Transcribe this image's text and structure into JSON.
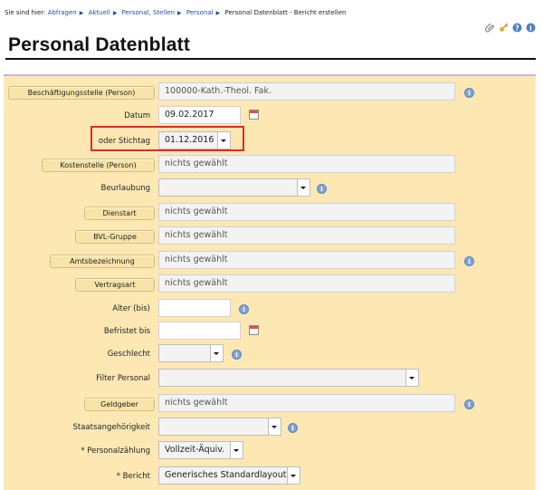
{
  "breadcrumb": {
    "prefix": "Sie sind hier:",
    "items": [
      "Abfragen",
      "Aktuell",
      "Personal, Stellen",
      "Personal",
      "Personal Datenblatt - Bericht erstellen"
    ]
  },
  "page_title": "Personal Datenblatt",
  "form": {
    "beschaeftigungsstelle": {
      "label": "Beschäftigungsstelle (Person)",
      "value": "100000-Kath.-Theol. Fak."
    },
    "datum": {
      "label": "Datum",
      "value": "09.02.2017"
    },
    "stichtag": {
      "label": "oder Stichtag",
      "value": "01.12.2016"
    },
    "kostenstelle": {
      "label": "Kostenstelle (Person)",
      "value": "nichts gewählt"
    },
    "beurlaubung": {
      "label": "Beurlaubung",
      "value": ""
    },
    "dienstart": {
      "label": "Dienstart",
      "value": "nichts gewählt"
    },
    "bvl_gruppe": {
      "label": "BVL-Gruppe",
      "value": "nichts gewählt"
    },
    "amtsbezeichnung": {
      "label": "Amtsbezeichnung",
      "value": "nichts gewählt"
    },
    "vertragsart": {
      "label": "Vertragsart",
      "value": "nichts gewählt"
    },
    "alter": {
      "label": "Alter (bis)",
      "value": ""
    },
    "befristet": {
      "label": "Befristet bis",
      "value": ""
    },
    "geschlecht": {
      "label": "Geschlecht",
      "value": ""
    },
    "filter_personal": {
      "label": "Filter Personal",
      "value": ""
    },
    "geldgeber": {
      "label": "Geldgeber",
      "value": "nichts gewählt"
    },
    "staatsangehoerigkeit": {
      "label": "Staatsangehörigkeit",
      "value": ""
    },
    "personalzaehlung": {
      "label": "* Personalzählung",
      "value": "Vollzeit-Äquiv."
    },
    "bericht": {
      "label": "* Bericht",
      "value": "Generisches Standardlayout"
    }
  },
  "colors": {
    "panel_bg": "#fde8b4",
    "highlight": "#e8252b",
    "info": "#7fa3d6"
  },
  "icons": [
    "paperclip-icon",
    "key-icon",
    "help-icon",
    "info-icon",
    "calendar-icon"
  ]
}
